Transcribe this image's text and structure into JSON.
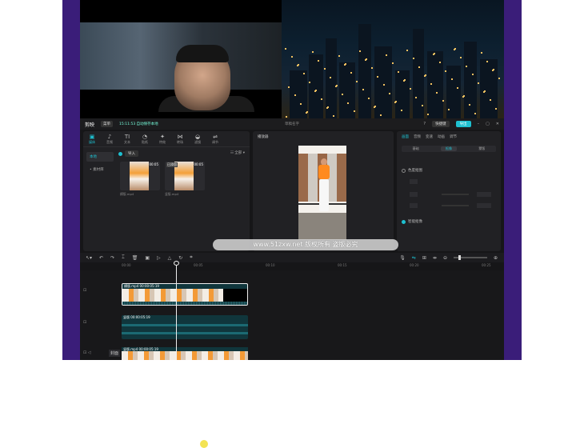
{
  "window": {
    "app_name": "剪映",
    "menu_label": "菜单",
    "autosave_status": "15:11:53 自动保存本地",
    "project_title": "草稿名字",
    "shortcut_label": "快捷键",
    "export_label": "导出"
  },
  "media_panel": {
    "tools": [
      {
        "icon": "▣",
        "label": "媒体",
        "active": true
      },
      {
        "icon": "♪",
        "label": "音频",
        "active": false
      },
      {
        "icon": "TI",
        "label": "文本",
        "active": false
      },
      {
        "icon": "◔",
        "label": "贴纸",
        "active": false
      },
      {
        "icon": "✦",
        "label": "特效",
        "active": false
      },
      {
        "icon": "⋈",
        "label": "转场",
        "active": false
      },
      {
        "icon": "◒",
        "label": "滤镜",
        "active": false
      },
      {
        "icon": "⇌",
        "label": "调节",
        "active": false
      }
    ],
    "side_items": [
      "本地",
      "• 素材库"
    ],
    "import_label": "导入",
    "sort_label": "☷ 全部 ▾",
    "clips": [
      {
        "duration": "00:05",
        "added": "",
        "name": "横版.mp4"
      },
      {
        "duration": "00:05",
        "added": "已添加",
        "name": "竖版.mp4"
      }
    ]
  },
  "player": {
    "title": "播放器"
  },
  "attributes": {
    "tabs": [
      "画面",
      "音频",
      "变速",
      "动画",
      "调节"
    ],
    "active_tab": "画面",
    "subtabs": [
      "基础",
      "抠像",
      "蒙版"
    ],
    "active_subtab": "抠像",
    "option_chroma": "色度抠图",
    "option_smart": "智能抠像"
  },
  "watermark": "www.51zxw.net 版权所有 盗版必究",
  "timeline": {
    "ruler_ticks": [
      "00:00",
      "00:05",
      "00:10",
      "00:15",
      "00:20",
      "00:25"
    ],
    "main_clip_label": "横版.mp4  00:00:05:19",
    "audio_clip_label": "竖版  00:00:05:19",
    "bottom_clip_label": "竖版.mp4  00:00:05:19",
    "cover_label": "封面"
  },
  "colors": {
    "accent": "#1ec0d0",
    "background": "#161618",
    "frame": "#3a1d79"
  }
}
